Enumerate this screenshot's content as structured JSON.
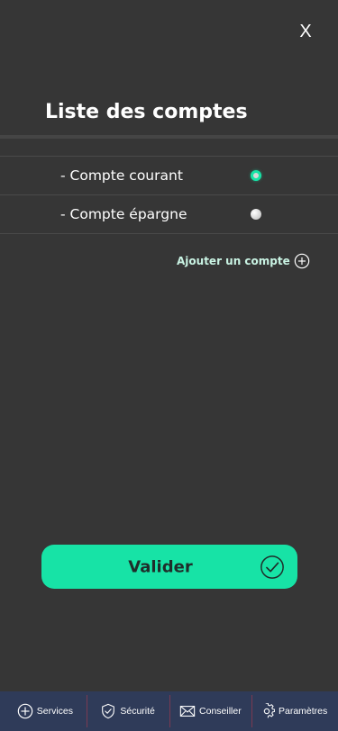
{
  "header": {
    "close_label": "X",
    "title": "Liste des comptes"
  },
  "accounts": [
    {
      "label": "- Compte courant",
      "selected": true
    },
    {
      "label": "- Compte épargne",
      "selected": false
    }
  ],
  "add_account": {
    "label": "Ajouter un compte",
    "icon": "plus-circle-icon"
  },
  "validate": {
    "label": "Valider",
    "icon": "check-circle-icon"
  },
  "bottom_nav": {
    "items": [
      {
        "label": "Services",
        "icon": "plus-circle-icon"
      },
      {
        "label": "Sécurité",
        "icon": "shield-check-icon"
      },
      {
        "label": "Conseiller",
        "icon": "envelope-icon"
      },
      {
        "label": "Paramètres",
        "icon": "gear-icon"
      }
    ]
  },
  "colors": {
    "background": "#363636",
    "accent": "#17e3a6",
    "nav_background": "#2f3b59",
    "nav_divider": "#7a3a52"
  }
}
